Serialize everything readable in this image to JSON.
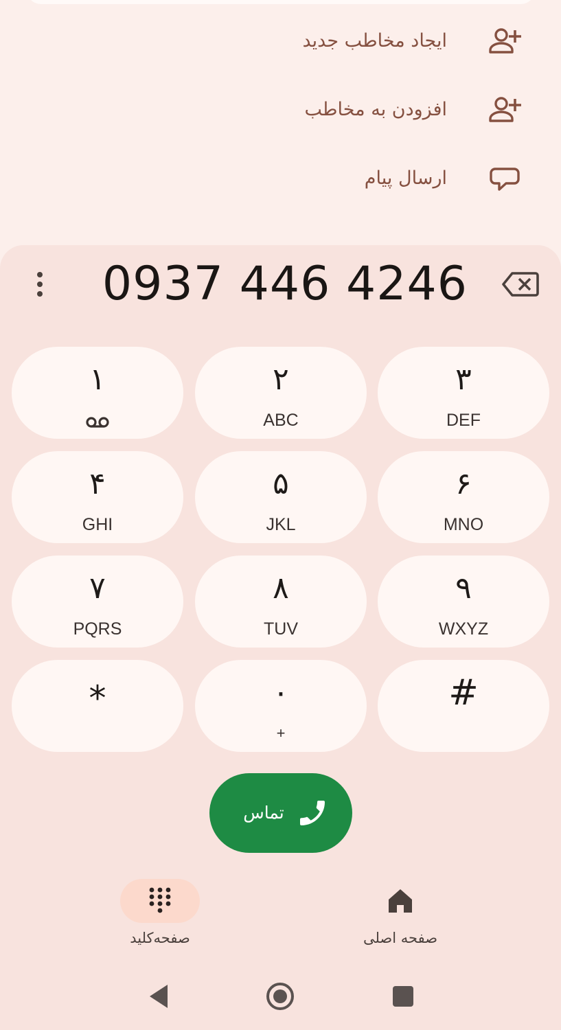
{
  "actions": [
    {
      "label": "ایجاد مخاطب جدید",
      "icon": "person-add-icon"
    },
    {
      "label": "افزودن به مخاطب",
      "icon": "person-add-icon"
    },
    {
      "label": "ارسال پیام",
      "icon": "message-icon"
    }
  ],
  "dialer": {
    "number": "0937 446 4246",
    "more_icon": "more-vert-icon",
    "backspace_icon": "backspace-icon"
  },
  "keypad": [
    {
      "digit": "۱",
      "letters": "",
      "sub_icon": "voicemail-icon"
    },
    {
      "digit": "۲",
      "letters": "ABC"
    },
    {
      "digit": "۳",
      "letters": "DEF"
    },
    {
      "digit": "۴",
      "letters": "GHI"
    },
    {
      "digit": "۵",
      "letters": "JKL"
    },
    {
      "digit": "۶",
      "letters": "MNO"
    },
    {
      "digit": "۷",
      "letters": "PQRS"
    },
    {
      "digit": "۸",
      "letters": "TUV"
    },
    {
      "digit": "۹",
      "letters": "WXYZ"
    },
    {
      "digit": "*",
      "letters": ""
    },
    {
      "digit": "۰",
      "letters": "+"
    },
    {
      "digit": "#",
      "letters": ""
    }
  ],
  "call_button": {
    "label": "تماس",
    "icon": "phone-icon",
    "color": "#1e8b44"
  },
  "bottom_nav": {
    "keypad_tab": {
      "label": "صفحه‌کلید",
      "icon": "dialpad-icon",
      "active": true
    },
    "home_tab": {
      "label": "صفحه اصلی",
      "icon": "home-icon",
      "active": false
    }
  },
  "system_nav": {
    "back": "back-icon",
    "home": "home-circle-icon",
    "recents": "recents-icon"
  },
  "colors": {
    "accent_brown": "#855040",
    "call_green": "#1e8b44",
    "active_pill": "#fcd9cc"
  }
}
